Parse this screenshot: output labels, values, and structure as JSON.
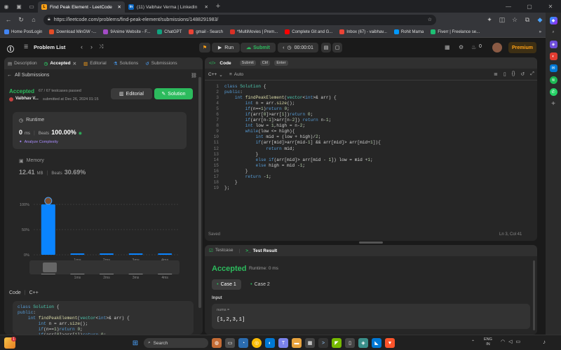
{
  "browser": {
    "tabs": [
      {
        "title": "Find Peak Element - LeetCode",
        "active": true
      },
      {
        "title": "(11) Vaibhav Verma | LinkedIn",
        "active": false
      }
    ],
    "new_tab_symbol": "+",
    "url": "https://leetcode.com/problems/find-peak-element/submissions/1488291983/",
    "bookmarks": [
      {
        "label": "Home PostLogin",
        "color": "#4285f4"
      },
      {
        "label": "Download MinGW -...",
        "color": "#e34c26"
      },
      {
        "label": "9Anime Website - F...",
        "color": "#a44cc7"
      },
      {
        "label": "ChatGPT",
        "color": "#10a37f"
      },
      {
        "label": "gmail - Search",
        "color": "#ea4335"
      },
      {
        "label": "*MultiMovies | Prem...",
        "color": "#d93025"
      },
      {
        "label": "Complete Git and G...",
        "color": "#ff0000"
      },
      {
        "label": "Inbox (67) - vaibhav...",
        "color": "#ea4335"
      },
      {
        "label": "Rohit Mama",
        "color": "#0098ff"
      },
      {
        "label": "Fiverr | Freelance se...",
        "color": "#1dbf73"
      }
    ],
    "more_bookmarks": "»"
  },
  "lc_nav": {
    "problem_list": "Problem List",
    "run": "Run",
    "submit": "Submit",
    "timer": "00:00:01",
    "coins": "0",
    "premium": "Premium"
  },
  "left": {
    "tabs": [
      "Description",
      "Accepted",
      "Editorial",
      "Solutions",
      "Submissions"
    ],
    "all_submissions": "All Submissions",
    "status": "Accepted",
    "testcases": "67 / 67 testcases passed",
    "user": "Vaibhav V...",
    "submitted": "submitted at Dec 26, 2024 01:15",
    "editorial_btn": "Editorial",
    "solution_btn": "Solution",
    "runtime_label": "Runtime",
    "runtime_value": "0",
    "runtime_unit": "ms",
    "beats_label": "Beats",
    "beats_value": "100.00%",
    "analyze": "Analyze Complexity",
    "memory_label": "Memory",
    "memory_value": "12.41",
    "memory_unit": "MB",
    "memory_beats_label": "Beats",
    "memory_beats_value": "30.69%",
    "code_label": "Code",
    "lang": "C++"
  },
  "chart_data": {
    "type": "bar",
    "categories": [
      "0ms",
      "1ms",
      "2ms",
      "3ms",
      "4ms"
    ],
    "values": [
      100,
      2,
      2,
      2,
      2
    ],
    "x_tick_labels": [
      "",
      "1ms",
      "2ms",
      "3ms",
      "4ms"
    ],
    "y_ticks": [
      "100%",
      "50%",
      "0%"
    ],
    "ylim": [
      0,
      100
    ],
    "bar_color": "#0a84ff"
  },
  "code": {
    "tab": "Code",
    "hint_submit": "Submit",
    "hint_ctrl": "Ctrl",
    "hint_enter": "Enter",
    "lang": "C++",
    "mode": "Auto",
    "saved": "Saved",
    "cursor": "Ln 3, Col 41",
    "lines": [
      "class Solution {",
      "public:",
      "    int findPeakElement(vector<int>& arr) {",
      "        int n = arr.size();",
      "        if(n==1)return 0;",
      "        if(arr[0]>arr[1])return 0;",
      "        if(arr[n-1]>arr[n-2]) return n-1;",
      "        int low = 1,high = n-2;",
      "        while(low <= high){",
      "            int mid = (low + high)/2;",
      "            if(arr[mid]>arr[mid-1] && arr[mid]> arr[mid+1]){",
      "                return mid;",
      "            }",
      "            else if(arr[mid]> arr[mid - 1]) low = mid +1;",
      "            else high = mid -1;",
      "        }",
      "        return -1;",
      "    }",
      "};"
    ]
  },
  "test": {
    "tab_testcase": "Testcase",
    "tab_result": "Test Result",
    "status": "Accepted",
    "runtime": "Runtime: 0 ms",
    "case1": "Case 1",
    "case2": "Case 2",
    "input_label": "Input",
    "var_name": "nums =",
    "var_value": "[1,2,3,1]"
  },
  "taskbar": {
    "search": "Search",
    "lang": "ENG",
    "region": "IN",
    "weather_badge": "1"
  },
  "colors": {
    "accent_green": "#2cbb5d",
    "brand_orange": "#ffa116",
    "blue": "#0a84ff"
  }
}
